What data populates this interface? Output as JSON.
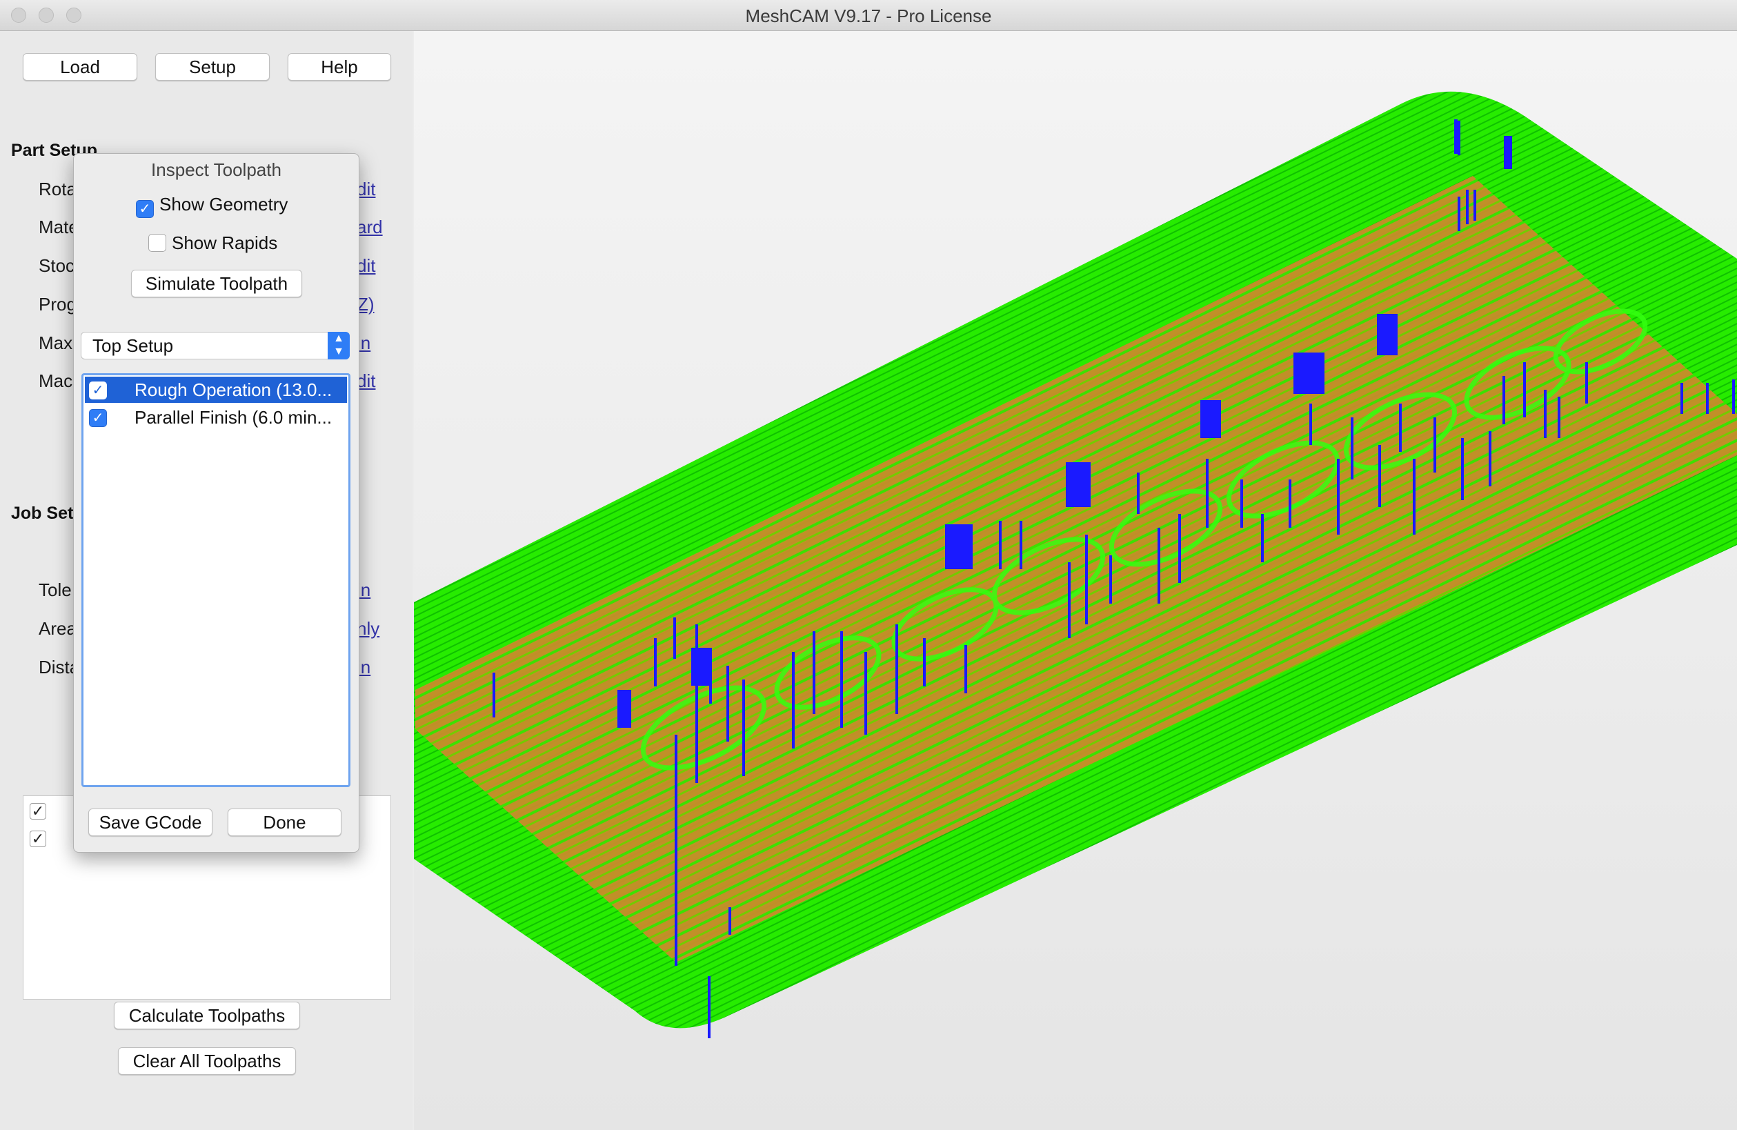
{
  "window": {
    "title": "MeshCAM V9.17 - Pro License"
  },
  "toolbar": {
    "load": "Load",
    "setup": "Setup",
    "help": "Help"
  },
  "part_setup": {
    "heading": "Part Setup",
    "rows": [
      {
        "label": "Rota",
        "link": "dit"
      },
      {
        "label": "Mate",
        "link": "ard"
      },
      {
        "label": "Stoc",
        "link": "dit"
      },
      {
        "label": "Prog",
        "link": "Z)"
      },
      {
        "label": "Max",
        "link": " in"
      },
      {
        "label": "Mac",
        "link": "dit"
      }
    ]
  },
  "job_setup": {
    "heading": "Job Setu",
    "rows": [
      {
        "label": "Tole",
        "link": " in"
      },
      {
        "label": "Area",
        "link": "nly"
      },
      {
        "label": "Dista",
        "link": " in"
      }
    ]
  },
  "bottom_buttons": {
    "calculate": "Calculate Toolpaths",
    "clear": "Clear All Toolpaths"
  },
  "dialog": {
    "title": "Inspect Toolpath",
    "show_geometry": {
      "label": "Show Geometry",
      "checked": true
    },
    "show_rapids": {
      "label": "Show Rapids",
      "checked": false
    },
    "simulate": "Simulate Toolpath",
    "setup_select": {
      "value": "Top Setup"
    },
    "operations": [
      {
        "label": "Rough Operation (13.0...",
        "checked": true,
        "selected": true
      },
      {
        "label": "Parallel Finish (6.0 min...",
        "checked": true,
        "selected": false
      }
    ],
    "save_gcode": "Save GCode",
    "done": "Done"
  },
  "colors": {
    "toolpath_green": "#22ee00",
    "stock_orange": "#c98b2a",
    "rapid_blue": "#1a1aff",
    "selection_blue": "#1f62d6"
  }
}
